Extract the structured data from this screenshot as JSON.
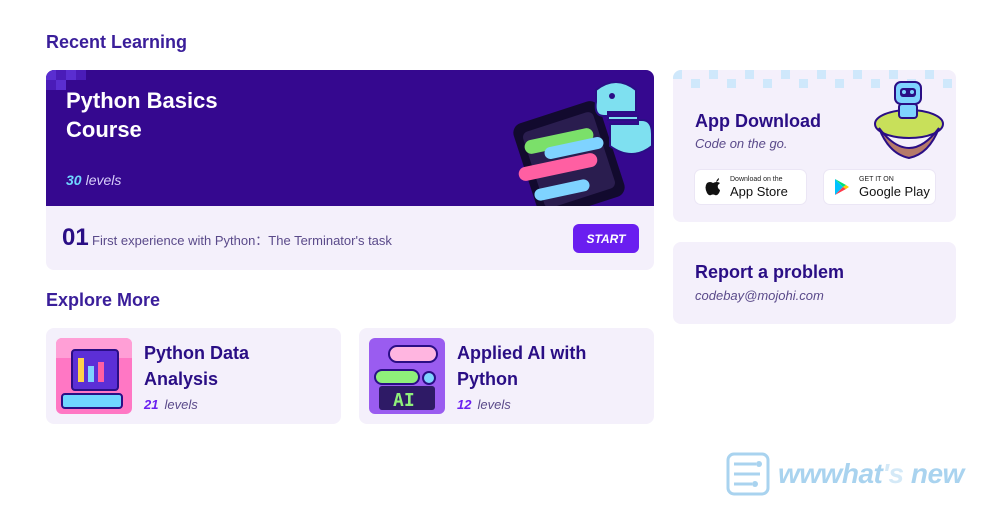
{
  "recent": {
    "section_title": "Recent Learning",
    "course": {
      "title": "Python Basics Course",
      "levels_count": "30",
      "levels_label": "levels",
      "lesson_number": "01",
      "lesson_title": "First experience with Python：The Terminator's task",
      "start_label": "START"
    }
  },
  "explore": {
    "section_title": "Explore More",
    "items": [
      {
        "title": "Python Data Analysis",
        "levels_count": "21",
        "levels_label": "levels",
        "thumb_icon": "data-analysis-icon"
      },
      {
        "title": "Applied AI with Python",
        "levels_count": "12",
        "levels_label": "levels",
        "thumb_icon": "ai-icon"
      }
    ]
  },
  "app_download": {
    "title": "App Download",
    "subtitle": "Code on the go.",
    "app_store": {
      "small": "Download on the",
      "big": "App Store",
      "icon": "apple-icon"
    },
    "google_play": {
      "small": "GET IT ON",
      "big": "Google Play",
      "icon": "google-play-icon"
    }
  },
  "report": {
    "title": "Report a problem",
    "email": "codebay@mojohi.com"
  },
  "watermark": {
    "part1": "wwwhat",
    "part2": "'s",
    "part3": "new"
  },
  "colors": {
    "brand_purple": "#35088f",
    "accent": "#6a1ef0",
    "card_bg": "#f4f0fb",
    "heading": "#2a0e85"
  }
}
